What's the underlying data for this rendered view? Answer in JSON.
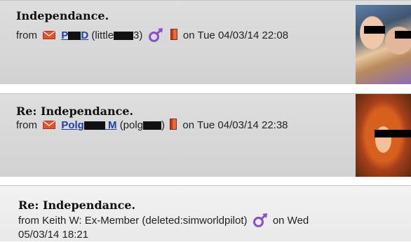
{
  "posts": [
    {
      "title": "Independance.",
      "from_label": "from",
      "username_visible": "P",
      "username_tail": "D",
      "handle_prefix": "(little",
      "handle_suffix": "3)",
      "on_text": "on Tue 04/03/14 22:08"
    },
    {
      "title": "Re: Independance.",
      "from_label": "from",
      "username_visible": "Polg",
      "username_tail": " M",
      "handle_prefix": "(polg",
      "handle_suffix": ")",
      "on_text": "on Tue 04/03/14 22:38"
    },
    {
      "title": "Re: Independance.",
      "meta_prefix": "from Keith W: Ex-Member (deleted:simworldpilot)",
      "on_text": "on Wed",
      "date_line2": "05/03/14 18:21"
    }
  ],
  "icons": {
    "message": "envelope-icon",
    "gender": "male-icon",
    "flag": "flag-icon"
  },
  "colors": {
    "username_link": "#1f3fa6",
    "male_icon": "#8a4fc8",
    "envelope": "#e0542a"
  }
}
